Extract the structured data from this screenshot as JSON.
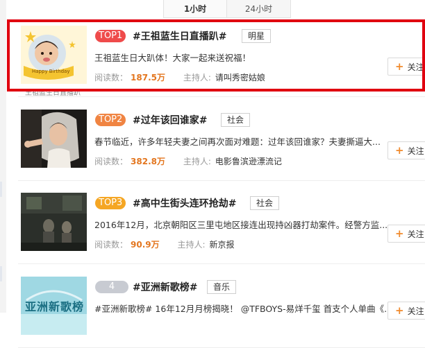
{
  "tabs": [
    {
      "label": "1小时",
      "active": true
    },
    {
      "label": "24小时",
      "active": false
    }
  ],
  "topics": [
    {
      "rank": "TOP1",
      "title": "#王祖蓝生日直播趴#",
      "category": "明星",
      "description": "王祖蓝生日大趴体！大家一起来送祝福！",
      "reads_label": "阅读数：",
      "reads": "187.5万",
      "host_label": "主持人:",
      "host": "请叫秀密姑娘",
      "follow_label": "关注",
      "thumb_caption": "Happy Birthday",
      "under_label": "王祖蓝生日直播趴",
      "highlighted": true
    },
    {
      "rank": "TOP2",
      "title": "#过年该回谁家#",
      "category": "社会",
      "description": "春节临近，许多年轻夫妻之间再次面对难题：过年该回谁家？夫妻撕逼大...",
      "reads_label": "阅读数：",
      "reads": "382.8万",
      "host_label": "主持人:",
      "host": "电影鲁滨逊漂流记",
      "follow_label": "关注",
      "highlighted": false
    },
    {
      "rank": "TOP3",
      "title": "#高中生街头连环抢劫#",
      "category": "社会",
      "description": "2016年12月，北京朝阳区三里屯地区接连出现持凶器打劫案件。经警方监...",
      "reads_label": "阅读数：",
      "reads": "90.9万",
      "host_label": "主持人:",
      "host": "新京报",
      "follow_label": "关注",
      "highlighted": false
    },
    {
      "rank": "4",
      "title": "#亚洲新歌榜#",
      "category": "音乐",
      "description": "#亚洲新歌榜# 16年12月月榜揭晓！ @TFBOYS-易烊千玺 首支个人单曲《...",
      "follow_label": "关注",
      "thumb_caption": "亚洲新歌榜",
      "highlighted": false
    }
  ]
}
